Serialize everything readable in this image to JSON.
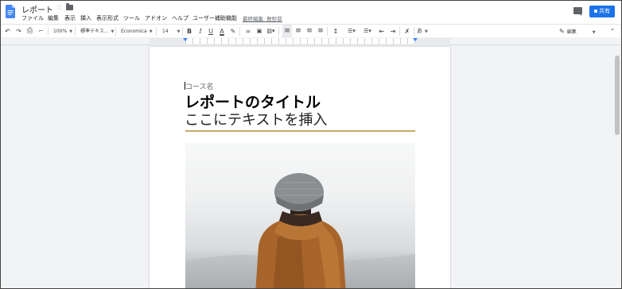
{
  "header": {
    "doc_title": "レポート",
    "menu": [
      "ファイル",
      "編集",
      "表示",
      "挿入",
      "表示形式",
      "ツール",
      "アドオン",
      "ヘルプ",
      "ユーザー補助機能"
    ],
    "last_edit": "最終編集: 数秒前",
    "share_label": "共有"
  },
  "toolbar": {
    "zoom": "100%",
    "style": "標準テキス...",
    "font": "Economica",
    "font_size": "14",
    "bold": "B",
    "italic": "I",
    "underline": "U",
    "text_color": "A",
    "input_tools": "あ",
    "mode": "編集"
  },
  "document": {
    "course_name": "コース名",
    "title": "レポートのタイトル",
    "subtitle": "ここにテキストを挿入"
  },
  "colors": {
    "accent_blue": "#1a73e8",
    "gold_rule": "#c8a96a",
    "canvas": "#f1f3f4"
  }
}
